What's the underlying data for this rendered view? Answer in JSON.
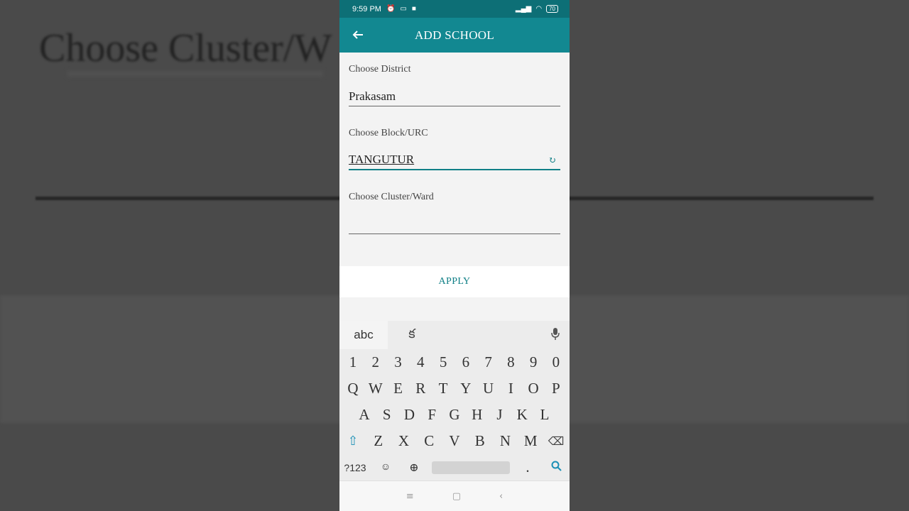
{
  "background": {
    "title": "Choose Cluster/W"
  },
  "status_bar": {
    "time": "9:59 PM",
    "battery": "70"
  },
  "app_bar": {
    "title": "ADD SCHOOL"
  },
  "form": {
    "district": {
      "label": "Choose District",
      "value": "Prakasam"
    },
    "block": {
      "label": "Choose Block/URC",
      "value": "TANGUTUR"
    },
    "cluster": {
      "label": "Choose Cluster/Ward",
      "value": ""
    },
    "apply_label": "APPLY"
  },
  "keyboard": {
    "tab_abc": "abc",
    "tab_lang": "క",
    "row_numbers": [
      "1",
      "2",
      "3",
      "4",
      "5",
      "6",
      "7",
      "8",
      "9",
      "0"
    ],
    "row_1": [
      "Q",
      "W",
      "E",
      "R",
      "T",
      "Y",
      "U",
      "I",
      "O",
      "P"
    ],
    "row_2": [
      "A",
      "S",
      "D",
      "F",
      "G",
      "H",
      "J",
      "K",
      "L"
    ],
    "row_3": [
      "Z",
      "X",
      "C",
      "V",
      "B",
      "N",
      "M"
    ],
    "sym_label": "?123",
    "period": "."
  },
  "colors": {
    "status_bar": "#0d6f76",
    "app_bar": "#128891",
    "accent": "#0f7f86"
  }
}
